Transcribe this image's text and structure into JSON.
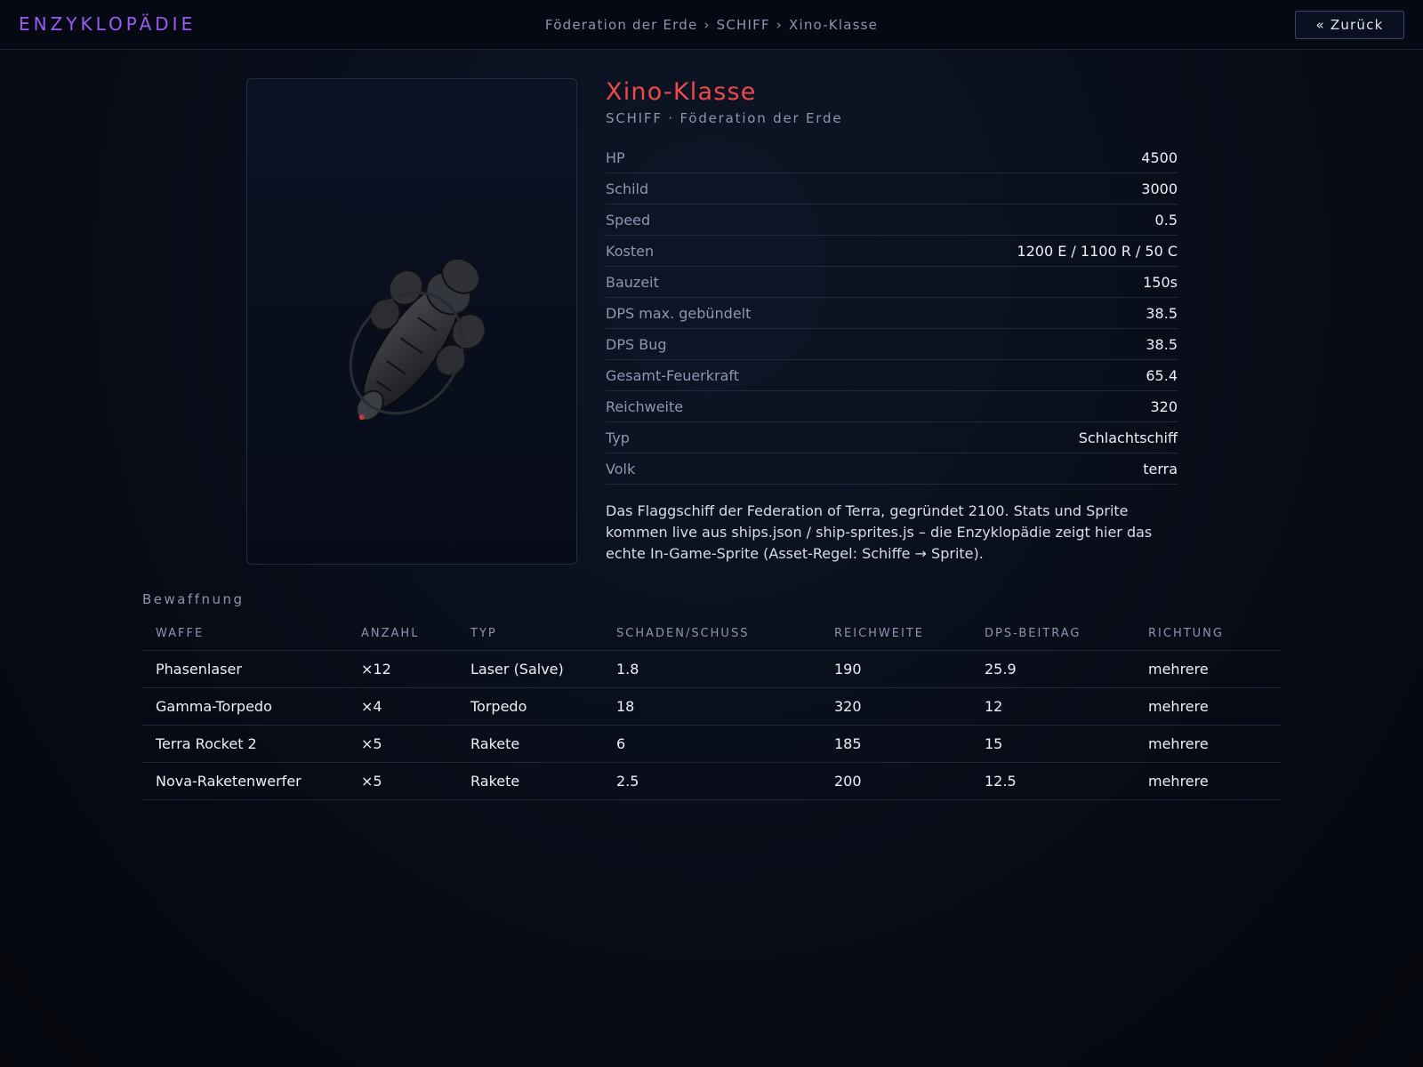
{
  "header": {
    "brand": "ENZYKLOPÄDIE",
    "breadcrumb": [
      "Föderation der Erde",
      "SCHIFF",
      "Xino-Klasse"
    ],
    "separator": "›",
    "back_label": "« Zurück"
  },
  "ship": {
    "name": "Xino-Klasse",
    "subtitle": "SCHIFF · Föderation der Erde",
    "stats": [
      {
        "label": "HP",
        "value": "4500"
      },
      {
        "label": "Schild",
        "value": "3000"
      },
      {
        "label": "Speed",
        "value": "0.5"
      },
      {
        "label": "Kosten",
        "value": "1200 E / 1100 R / 50 C"
      },
      {
        "label": "Bauzeit",
        "value": "150s"
      },
      {
        "label": "DPS max. gebündelt",
        "value": "38.5"
      },
      {
        "label": "DPS Bug",
        "value": "38.5"
      },
      {
        "label": "Gesamt-Feuerkraft",
        "value": "65.4"
      },
      {
        "label": "Reichweite",
        "value": "320"
      },
      {
        "label": "Typ",
        "value": "Schlachtschiff"
      },
      {
        "label": "Volk",
        "value": "terra"
      }
    ],
    "description": "Das Flaggschiff der Federation of Terra, gegründet 2100. Stats und Sprite kommen live aus ships.json / ship-sprites.js – die Enzyklopädie zeigt hier das echte In-Game-Sprite (Asset-Regel: Schiffe → Sprite)."
  },
  "weapons": {
    "title": "Bewaffnung",
    "columns": [
      "WAFFE",
      "ANZAHL",
      "TYP",
      "SCHADEN/SCHUSS",
      "REICHWEITE",
      "DPS-BEITRAG",
      "RICHTUNG"
    ],
    "rows": [
      [
        "Phasenlaser",
        "×12",
        "Laser (Salve)",
        "1.8",
        "190",
        "25.9",
        "mehrere"
      ],
      [
        "Gamma-Torpedo",
        "×4",
        "Torpedo",
        "18",
        "320",
        "12",
        "mehrere"
      ],
      [
        "Terra Rocket 2",
        "×5",
        "Rakete",
        "6",
        "185",
        "15",
        "mehrere"
      ],
      [
        "Nova-Raketenwerfer",
        "×5",
        "Rakete",
        "2.5",
        "200",
        "12.5",
        "mehrere"
      ]
    ]
  },
  "colors": {
    "brand": "#9a5cf0",
    "title": "#ef4a4a",
    "muted": "#8d95ad",
    "background": "#080c17"
  },
  "icons": {
    "ship_sprite": "xino-class-battleship-sprite"
  }
}
